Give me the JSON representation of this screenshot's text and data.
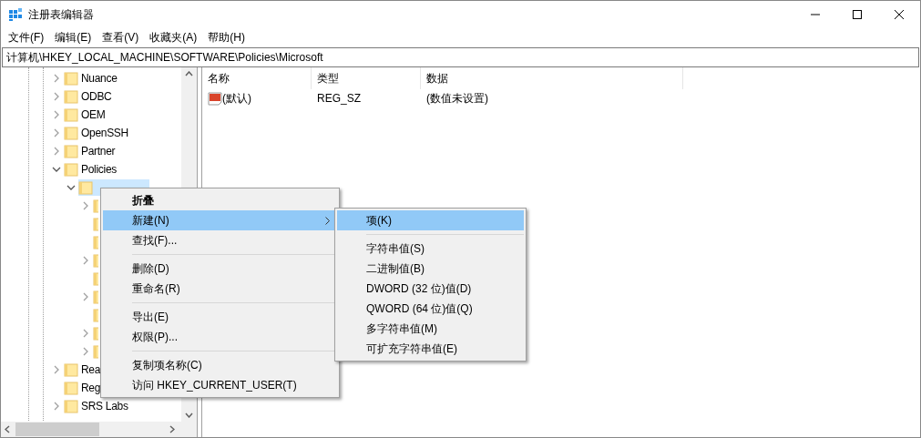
{
  "window": {
    "title": "注册表编辑器"
  },
  "menu_bar": [
    "文件(F)",
    "编辑(E)",
    "查看(V)",
    "收藏夹(A)",
    "帮助(H)"
  ],
  "address": "计算机\\HKEY_LOCAL_MACHINE\\SOFTWARE\\Policies\\Microsoft",
  "tree": [
    {
      "label": "Nuance",
      "expanded": false,
      "selected": false
    },
    {
      "label": "ODBC",
      "expanded": false,
      "selected": false
    },
    {
      "label": "OEM",
      "expanded": false,
      "selected": false
    },
    {
      "label": "OpenSSH",
      "expanded": false,
      "selected": false
    },
    {
      "label": "Partner",
      "expanded": false,
      "selected": false
    },
    {
      "label": "Policies",
      "expanded": true,
      "selected": false,
      "children": [
        {
          "expanded": true,
          "selected": true,
          "children": [
            {
              "expanded": false,
              "selected": false
            },
            {
              "selected": false
            },
            {
              "selected": false
            },
            {
              "expanded": false,
              "selected": false
            },
            {
              "selected": false
            },
            {
              "expanded": false,
              "selected": false
            },
            {
              "selected": false
            },
            {
              "expanded": false,
              "selected": false
            },
            {
              "expanded": false,
              "selected": false
            }
          ]
        }
      ]
    },
    {
      "label": "Rea",
      "expanded": false,
      "selected": false
    },
    {
      "label": "Reg",
      "selected": false
    },
    {
      "label": "SRS Labs",
      "expanded": false,
      "selected": false
    }
  ],
  "values": {
    "columns": [
      "名称",
      "类型",
      "数据"
    ],
    "rows": [
      {
        "name": "(默认)",
        "type": "REG_SZ",
        "data": "(数值未设置)"
      }
    ]
  },
  "context_menu": [
    {
      "kind": "item",
      "label": "折叠",
      "default": true,
      "selected": false
    },
    {
      "kind": "item",
      "label": "新建(N)",
      "submenu": true,
      "selected": true
    },
    {
      "kind": "item",
      "label": "查找(F)...",
      "selected": false
    },
    {
      "kind": "separator"
    },
    {
      "kind": "item",
      "label": "删除(D)",
      "selected": false
    },
    {
      "kind": "item",
      "label": "重命名(R)",
      "selected": false
    },
    {
      "kind": "separator"
    },
    {
      "kind": "item",
      "label": "导出(E)",
      "selected": false
    },
    {
      "kind": "item",
      "label": "权限(P)...",
      "selected": false
    },
    {
      "kind": "separator"
    },
    {
      "kind": "item",
      "label": "复制项名称(C)",
      "selected": false
    },
    {
      "kind": "item",
      "label": "访问 HKEY_CURRENT_USER(T)",
      "selected": false
    }
  ],
  "submenu": [
    {
      "kind": "item",
      "label": "项(K)",
      "selected": true
    },
    {
      "kind": "separator"
    },
    {
      "kind": "item",
      "label": "字符串值(S)",
      "selected": false
    },
    {
      "kind": "item",
      "label": "二进制值(B)",
      "selected": false
    },
    {
      "kind": "item",
      "label": "DWORD (32 位)值(D)",
      "selected": false
    },
    {
      "kind": "item",
      "label": "QWORD (64 位)值(Q)",
      "selected": false
    },
    {
      "kind": "item",
      "label": "多字符串值(M)",
      "selected": false
    },
    {
      "kind": "item",
      "label": "可扩充字符串值(E)",
      "selected": false
    }
  ]
}
